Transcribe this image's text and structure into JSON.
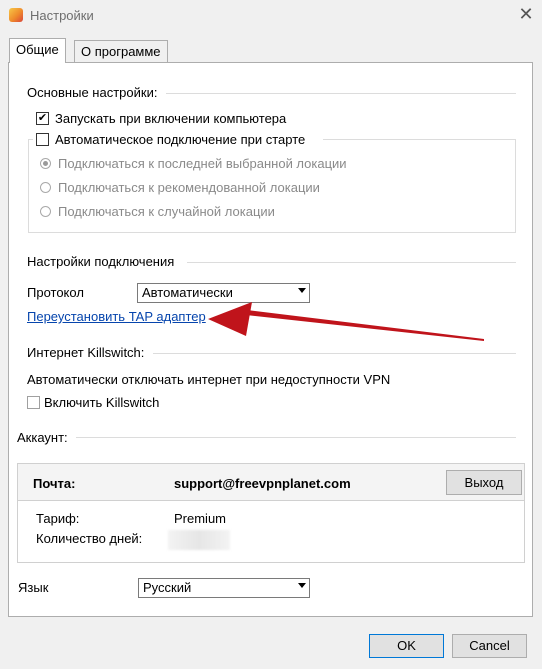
{
  "window": {
    "title": "Настройки",
    "close_glyph": "✕"
  },
  "tabs": [
    {
      "label": "Общие"
    },
    {
      "label": "О программе"
    }
  ],
  "general": {
    "heading": "Основные настройки:",
    "startup_label": "Запускать при включении компьютера",
    "startup_checked": true,
    "autoconnect_label": "Автоматическое подключение при старте",
    "autoconnect_checked": false,
    "radio_options": [
      {
        "label": "Подключаться к последней выбранной локации",
        "selected": true
      },
      {
        "label": "Подключаться к рекомендованной локации",
        "selected": false
      },
      {
        "label": "Подключаться к случайной локации",
        "selected": false
      }
    ]
  },
  "connection": {
    "heading": "Настройки подключения",
    "protocol_label": "Протокол",
    "protocol_value": "Автоматически",
    "reinstall_link": "Переустановить TAP адаптер"
  },
  "killswitch": {
    "heading": "Интернет Killswitch:",
    "description": "Автоматически отключать интернет при недоступности VPN",
    "enable_label": "Включить Killswitch",
    "enabled": false
  },
  "account": {
    "heading": "Аккаунт:",
    "email_label": "Почта:",
    "email_value": "support@freevpnplanet.com",
    "logout_label": "Выход",
    "plan_label": "Тариф:",
    "plan_value": "Premium",
    "days_label": "Количество дней:",
    "days_value": ""
  },
  "language": {
    "label": "Язык",
    "value": "Русский"
  },
  "footer": {
    "ok_label": "OK",
    "cancel_label": "Cancel"
  },
  "colors": {
    "link": "#0645ad",
    "annotation_arrow": "#c0141b",
    "primary_button_border": "#0078d7"
  }
}
